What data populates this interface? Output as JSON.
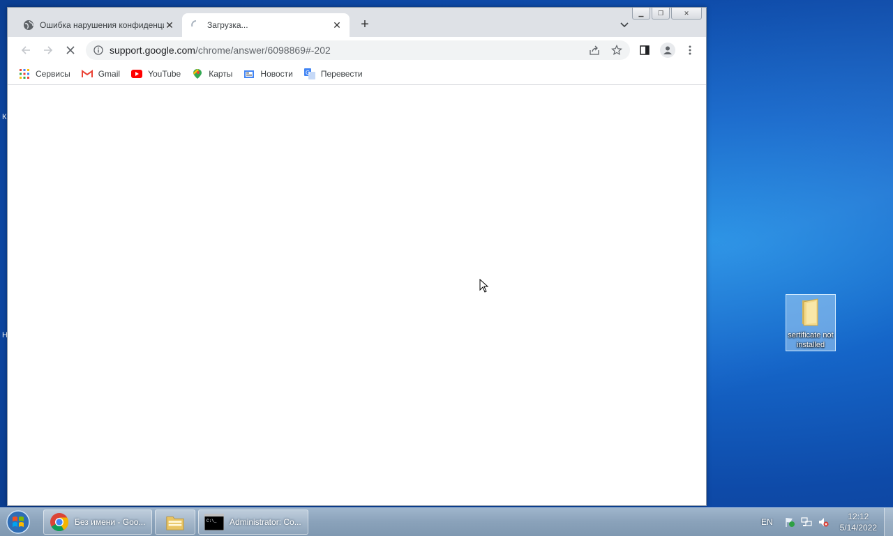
{
  "browser": {
    "tabs": [
      {
        "title": "Ошибка нарушения конфиденциальности",
        "active": false
      },
      {
        "title": "Загрузка...",
        "active": true
      }
    ],
    "url_host": "support.google.com",
    "url_path": "/chrome/answer/6098869#-202",
    "bookmarks": [
      {
        "label": "Сервисы",
        "icon": "apps-grid-icon"
      },
      {
        "label": "Gmail",
        "icon": "gmail-icon"
      },
      {
        "label": "YouTube",
        "icon": "youtube-icon"
      },
      {
        "label": "Карты",
        "icon": "maps-icon"
      },
      {
        "label": "Новости",
        "icon": "news-icon"
      },
      {
        "label": "Перевести",
        "icon": "translate-icon"
      }
    ]
  },
  "desktop": {
    "edge_letters": [
      "К",
      "Н"
    ],
    "icons": [
      {
        "label": "sertificate not installed",
        "icon": "folder-icon"
      }
    ]
  },
  "taskbar": {
    "items": [
      {
        "label": "Без имени - Goo...",
        "icon": "chrome-icon"
      },
      {
        "label": "",
        "icon": "file-explorer-icon"
      },
      {
        "label": "Administrator: Co...",
        "icon": "command-prompt-icon"
      }
    ],
    "language": "EN",
    "time": "12:12",
    "date": "5/14/2022"
  },
  "colors": {
    "desktop_blue": "#1565c8",
    "chrome_frame": "#dee1e6",
    "omnibox_bg": "#f1f3f4"
  }
}
